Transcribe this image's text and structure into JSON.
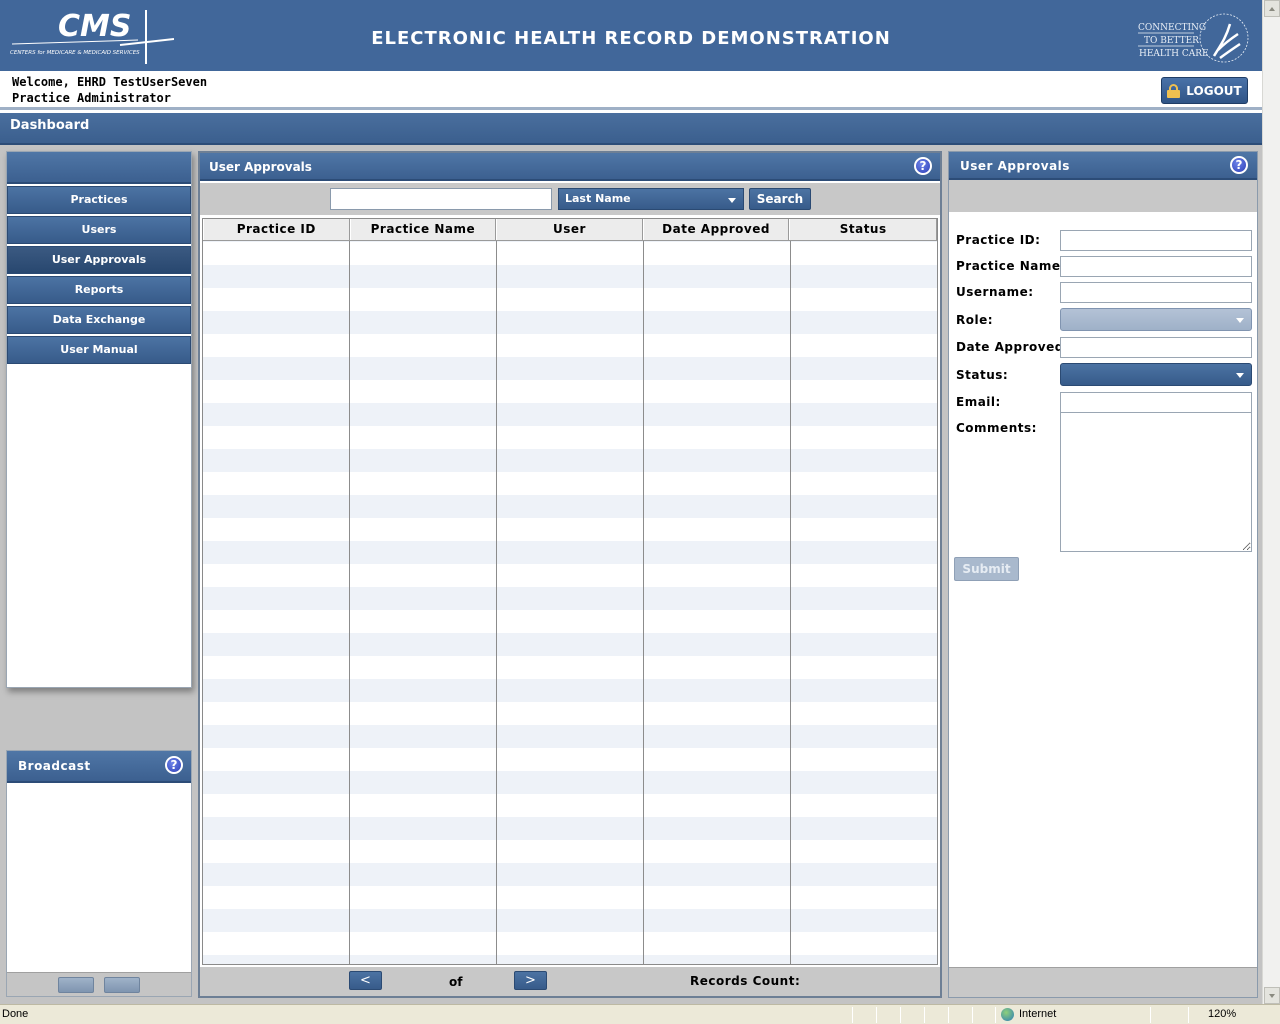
{
  "header": {
    "app_title": "ELECTRONIC HEALTH RECORD DEMONSTRATION",
    "cms_logo_text": "CMS",
    "cms_tagline": "CENTERS for MEDICARE & MEDICAID SERVICES",
    "hhs_tagline": [
      "CONNECTING",
      "TO BETTER",
      "HEALTH CARE"
    ]
  },
  "userbar": {
    "welcome": "Welcome, EHRD TestUserSeven",
    "role": "Practice Administrator",
    "logout_label": "LOGOUT"
  },
  "dashboard": {
    "title": "Dashboard"
  },
  "nav": {
    "items": [
      {
        "label": "Practices"
      },
      {
        "label": "Users"
      },
      {
        "label": "User Approvals"
      },
      {
        "label": "Reports"
      },
      {
        "label": "Data Exchange"
      },
      {
        "label": "User Manual"
      }
    ],
    "active": "User Approvals"
  },
  "broadcast": {
    "title": "Broadcast",
    "help": "?"
  },
  "center": {
    "title": "User Approvals",
    "help": "?",
    "search_value": "",
    "search_by": "Last Name",
    "search_label": "Search",
    "columns": [
      "Practice ID",
      "Practice Name",
      "User",
      "Date Approved",
      "Status"
    ],
    "rows": [],
    "pager": {
      "prev": "<",
      "next": ">",
      "of_label": "of",
      "records_count_label": "Records Count:"
    }
  },
  "details": {
    "title": "User Approvals",
    "help": "?",
    "fields": {
      "practice_id": {
        "label": "Practice ID:",
        "value": ""
      },
      "practice_name": {
        "label": "Practice Name:",
        "value": ""
      },
      "username": {
        "label": "Username:",
        "value": ""
      },
      "role": {
        "label": "Role:",
        "value": ""
      },
      "date_approved": {
        "label": "Date Approved:",
        "value": ""
      },
      "status": {
        "label": "Status:",
        "value": ""
      },
      "email": {
        "label": "Email:",
        "value": ""
      },
      "comments": {
        "label": "Comments:",
        "value": ""
      }
    },
    "submit_label": "Submit"
  },
  "statusbar": {
    "status": "Done",
    "zone": "Internet",
    "zoom": "120%"
  },
  "colors": {
    "header_bg": "#41679a",
    "panel_head": "#3c6090",
    "workspace_bg": "#c3c3c3",
    "help_icon": "#2d3fb8"
  }
}
